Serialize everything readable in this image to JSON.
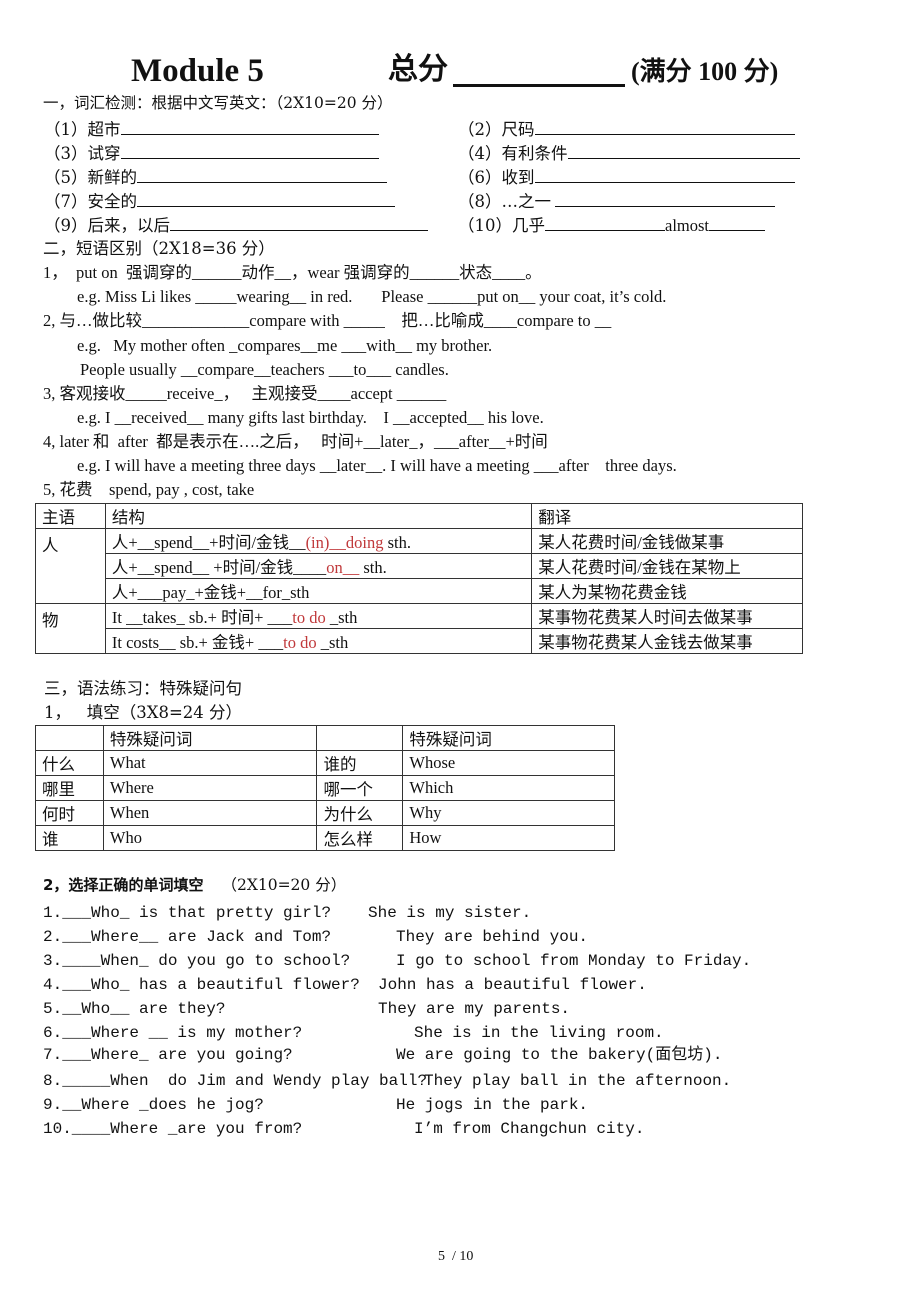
{
  "header": {
    "title": "Module 5",
    "total_label": "总分",
    "total_blank": "",
    "full_score": "(满分 100 分)"
  },
  "section1": {
    "heading": "一，词汇检测：根据中文写英文：（2X10=20 分）",
    "items": [
      {
        "num": "（1）",
        "cn": "超市",
        "answer": ""
      },
      {
        "num": "（2）",
        "cn": "尺码",
        "answer": ""
      },
      {
        "num": "（3）",
        "cn": "试穿",
        "answer": ""
      },
      {
        "num": "（4）",
        "cn": "有利条件",
        "answer": ""
      },
      {
        "num": "（5）",
        "cn": "新鲜的",
        "answer": ""
      },
      {
        "num": "（6）",
        "cn": "收到",
        "answer": ""
      },
      {
        "num": "（7）",
        "cn": "安全的",
        "answer": ""
      },
      {
        "num": "（8）",
        "cn": "…之一",
        "answer": ""
      },
      {
        "num": "（9）",
        "cn": "后来，以后",
        "answer": ""
      },
      {
        "num": "（10）",
        "cn": "几乎",
        "answer": "almost"
      }
    ]
  },
  "section2": {
    "heading": "二，短语区别（2X18=36 分）",
    "lines": [
      "1，  put on  强调穿的______动作__，wear 强调穿的______状态____。",
      "e.g. Miss Li likes _____wearing__ in red.       Please ______put on__ your coat, it’s cold.",
      "2, 与…做比较_____________compare with _____    把…比喻成____compare to __",
      "e.g.   My mother often _compares__me ___with__ my brother.",
      "People usually __compare__teachers ___to___ candles.",
      "3, 客观接收_____receive_，   主观接受____accept ______",
      "e.g. I __received__ many gifts last birthday.    I __accepted__ his love.",
      "4, later 和  after  都是表示在….之后，   时间+__later_，___after__+时间",
      "e.g. I will have a meeting three days __later__. I will have a meeting ___after    three days.",
      "5, 花费    spend, pay , cost, take"
    ],
    "table": {
      "headers": [
        "主语",
        "结构",
        "翻译"
      ],
      "groups": [
        {
          "subject": "人",
          "rows": [
            {
              "pre": "人+__spend__+时间/金钱__",
              "red": "(in)__doing",
              "post": " sth.",
              "translation": "某人花费时间/金钱做某事"
            },
            {
              "pre": "人+__spend__ +时间/金钱____",
              "red": "on__",
              "post": " sth.",
              "translation": "某人花费时间/金钱在某物上"
            },
            {
              "pre": "人+___pay_+金钱+__for_sth",
              "red": "",
              "post": "",
              "translation": "某人为某物花费金钱"
            }
          ]
        },
        {
          "subject": "物",
          "rows": [
            {
              "pre": "It __takes_ sb.+  时间+ ___",
              "red": "to do",
              "post": " _sth",
              "translation": "某事物花费某人时间去做某事"
            },
            {
              "pre": "It costs__ sb.+  金钱+ ___",
              "red": "to do",
              "post": " _sth",
              "translation": "某事物花费某人金钱去做某事"
            }
          ]
        }
      ]
    }
  },
  "section3": {
    "heading": "三，语法练习：特殊疑问句",
    "part1_heading": "1，   填空（3X8=24 分）",
    "table": {
      "header": [
        "",
        "特殊疑问词",
        "",
        "特殊疑问词"
      ],
      "rows": [
        [
          "什么",
          "What",
          "谁的",
          "Whose"
        ],
        [
          "哪里",
          "Where",
          "哪一个",
          "Which"
        ],
        [
          "何时",
          "When",
          "为什么",
          "Why"
        ],
        [
          "谁",
          "Who",
          "怎么样",
          "How"
        ]
      ]
    },
    "part2_heading": "2，选择正确的单词填空",
    "part2_score": "（2X10=20 分）",
    "questions": [
      {
        "q": "1.___Who_ is that pretty girl?",
        "a": "She is my sister."
      },
      {
        "q": "2.___Where__ are Jack and Tom?",
        "a": "They are behind you."
      },
      {
        "q": "3.____When_ do you go to school?",
        "a": "I go to school from Monday to Friday."
      },
      {
        "q": "4.___Who_ has a beautiful flower?",
        "a": "John has a beautiful flower."
      },
      {
        "q": "5.__Who__ are they?",
        "a": "They are my parents."
      },
      {
        "q": "6.___Where __ is my mother?",
        "a": "She is in the living room."
      },
      {
        "q": "7.___Where_ are you going?",
        "a": "We are going to the bakery(面包坊)."
      },
      {
        "q": "8._____When  do Jim and Wendy play ball?",
        "a": "They play ball in the afternoon."
      },
      {
        "q": "9.__Where _does he jog?",
        "a": "He jogs in the park."
      },
      {
        "q": "10.____Where _are you from?",
        "a": "I’m from Changchun city."
      }
    ]
  },
  "footer": {
    "page": "5  / 10"
  }
}
